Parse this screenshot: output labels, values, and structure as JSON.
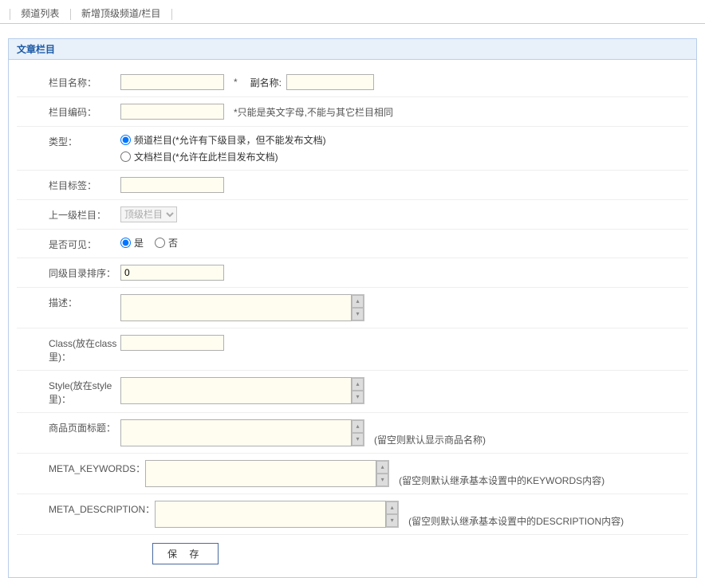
{
  "tabs": {
    "list": "频道列表",
    "add": "新增顶级频道/栏目"
  },
  "section": {
    "title": "文章栏目"
  },
  "labels": {
    "name": "栏目名称：",
    "subname": "副名称:",
    "code": "栏目编码：",
    "type": "类型：",
    "tags": "栏目标签：",
    "parent": "上一级栏目：",
    "visible": "是否可见：",
    "order": "同级目录排序：",
    "desc": "描述：",
    "class": "Class(放在class里)：",
    "style": "Style(放在style里)：",
    "pagetitle": "商品页面标题：",
    "keywords": "META_KEYWORDS：",
    "description": "META_DESCRIPTION："
  },
  "values": {
    "name": "",
    "subname": "",
    "code": "",
    "tags": "",
    "parent": "顶级栏目",
    "order": "0",
    "desc": "",
    "class": "",
    "style": "",
    "pagetitle": "",
    "keywords": "",
    "meta_description": ""
  },
  "notes": {
    "name_mark": "*",
    "code": "*只能是英文字母,不能与其它栏目相同",
    "pagetitle": "(留空则默认显示商品名称)",
    "keywords": "(留空则默认继承基本设置中的KEYWORDS内容)",
    "description": "(留空则默认继承基本设置中的DESCRIPTION内容)"
  },
  "options": {
    "type1": "频道栏目(*允许有下级目录，但不能发布文档)",
    "type2": "文档栏目(*允许在此栏目发布文档)",
    "visible_yes": "是",
    "visible_no": "否"
  },
  "buttons": {
    "save": "保 存"
  }
}
